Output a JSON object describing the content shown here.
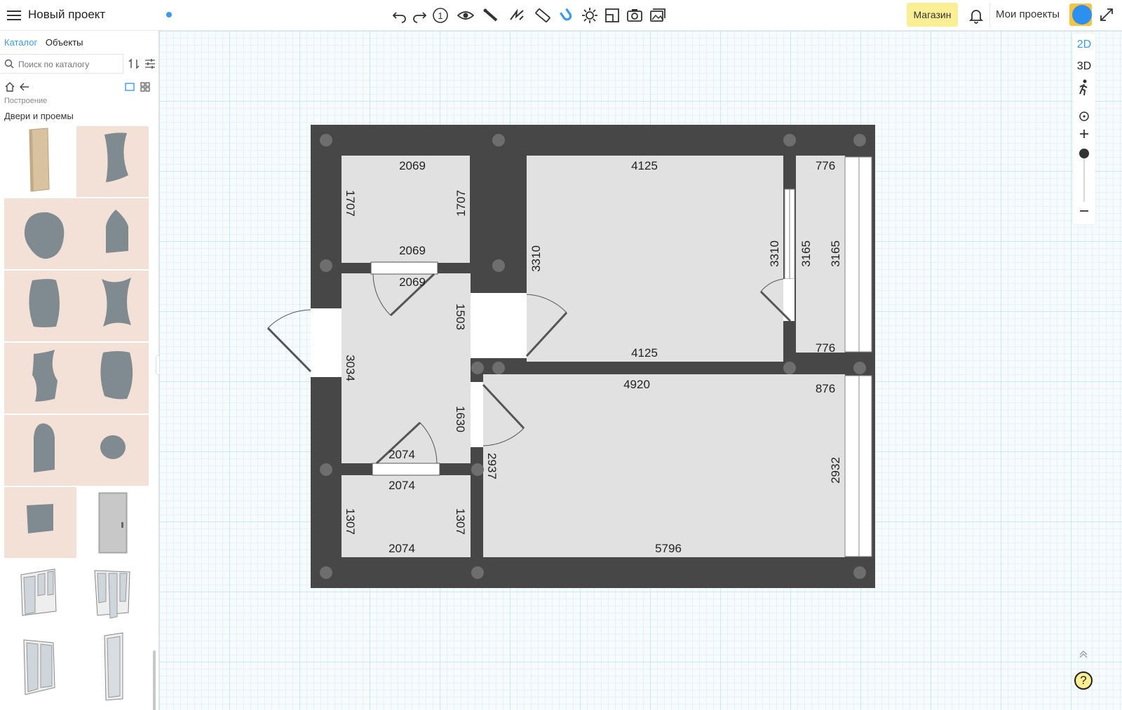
{
  "header": {
    "project_title": "Новый проект",
    "shop_label": "Магазин",
    "my_projects_label": "Мои проекты",
    "floor_number": "1"
  },
  "sidebar": {
    "tabs": [
      {
        "label": "Каталог",
        "active": true
      },
      {
        "label": "Объекты",
        "active": false
      }
    ],
    "search_placeholder": "Поиск по каталогу",
    "breadcrumb": "Построение",
    "section_title": "Двери и проемы",
    "items": [
      {
        "icon": "wooden-door",
        "bg": "white"
      },
      {
        "icon": "curved-opening",
        "bg": "pink"
      },
      {
        "icon": "round-opening",
        "bg": "pink"
      },
      {
        "icon": "onion-arch-opening",
        "bg": "pink"
      },
      {
        "icon": "barrel-opening",
        "bg": "pink"
      },
      {
        "icon": "concave-opening",
        "bg": "pink"
      },
      {
        "icon": "wave-opening",
        "bg": "pink"
      },
      {
        "icon": "convex-opening",
        "bg": "pink"
      },
      {
        "icon": "arch-opening",
        "bg": "pink"
      },
      {
        "icon": "circle-opening",
        "bg": "pink"
      },
      {
        "icon": "rect-opening",
        "bg": "pink"
      },
      {
        "icon": "metal-door",
        "bg": "white"
      },
      {
        "icon": "balcony-block",
        "bg": "white"
      },
      {
        "icon": "balcony-block-alt",
        "bg": "white"
      },
      {
        "icon": "double-glass-door",
        "bg": "white"
      },
      {
        "icon": "single-glass-door",
        "bg": "white"
      }
    ]
  },
  "view_modes": [
    "2D",
    "3D"
  ],
  "active_view": "2D",
  "plan": {
    "dimensions": [
      "2069",
      "1707",
      "1707",
      "2069",
      "2069",
      "1503",
      "3034",
      "4125",
      "3310",
      "3310",
      "3165",
      "3165",
      "776",
      "776",
      "4125",
      "4920",
      "876",
      "1630",
      "2937",
      "2932",
      "2074",
      "2074",
      "1307",
      "1307",
      "2074",
      "5796"
    ]
  },
  "help_label": "?",
  "colors": {
    "accent": "#3a9bea",
    "shop": "#fbef96",
    "wall": "#474747",
    "floor": "#e1e1e1"
  }
}
